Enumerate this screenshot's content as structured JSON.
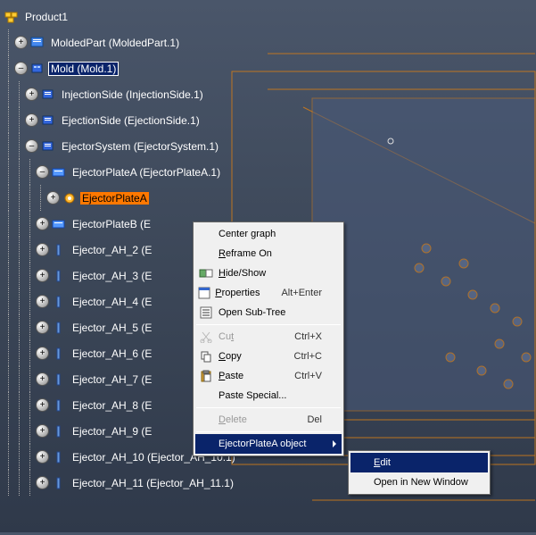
{
  "tree": {
    "root": "Product1",
    "molded_part": "MoldedPart (MoldedPart.1)",
    "mold": "Mold (Mold.1)",
    "injection_side": "InjectionSide (InjectionSide.1)",
    "ejection_side": "EjectionSide (EjectionSide.1)",
    "ejector_system": "EjectorSystem (EjectorSystem.1)",
    "ejector_plate_a": "EjectorPlateA (EjectorPlateA.1)",
    "ejector_plate_a_part": "EjectorPlateA",
    "ejector_plate_b": "EjectorPlateB (E",
    "ejectors": [
      "Ejector_AH_2 (E",
      "Ejector_AH_3 (E",
      "Ejector_AH_4 (E",
      "Ejector_AH_5 (E",
      "Ejector_AH_6 (E",
      "Ejector_AH_7 (E",
      "Ejector_AH_8 (E",
      "Ejector_AH_9 (E",
      "Ejector_AH_10 (Ejector_AH_10.1)",
      "Ejector_AH_11 (Ejector_AH_11.1)"
    ]
  },
  "context_menu": {
    "center_graph": "Center graph",
    "reframe_on": "Reframe On",
    "hide_show": "Hide/Show",
    "properties": "Properties",
    "properties_accel": "Alt+Enter",
    "open_subtree": "Open Sub-Tree",
    "cut": "Cut",
    "cut_accel": "Ctrl+X",
    "copy": "Copy",
    "copy_accel": "Ctrl+C",
    "paste": "Paste",
    "paste_accel": "Ctrl+V",
    "paste_special": "Paste Special...",
    "delete": "Delete",
    "delete_accel": "Del",
    "object_menu": "EjectorPlateA object"
  },
  "sub_menu": {
    "edit": "Edit",
    "open_new": "Open in New Window"
  }
}
